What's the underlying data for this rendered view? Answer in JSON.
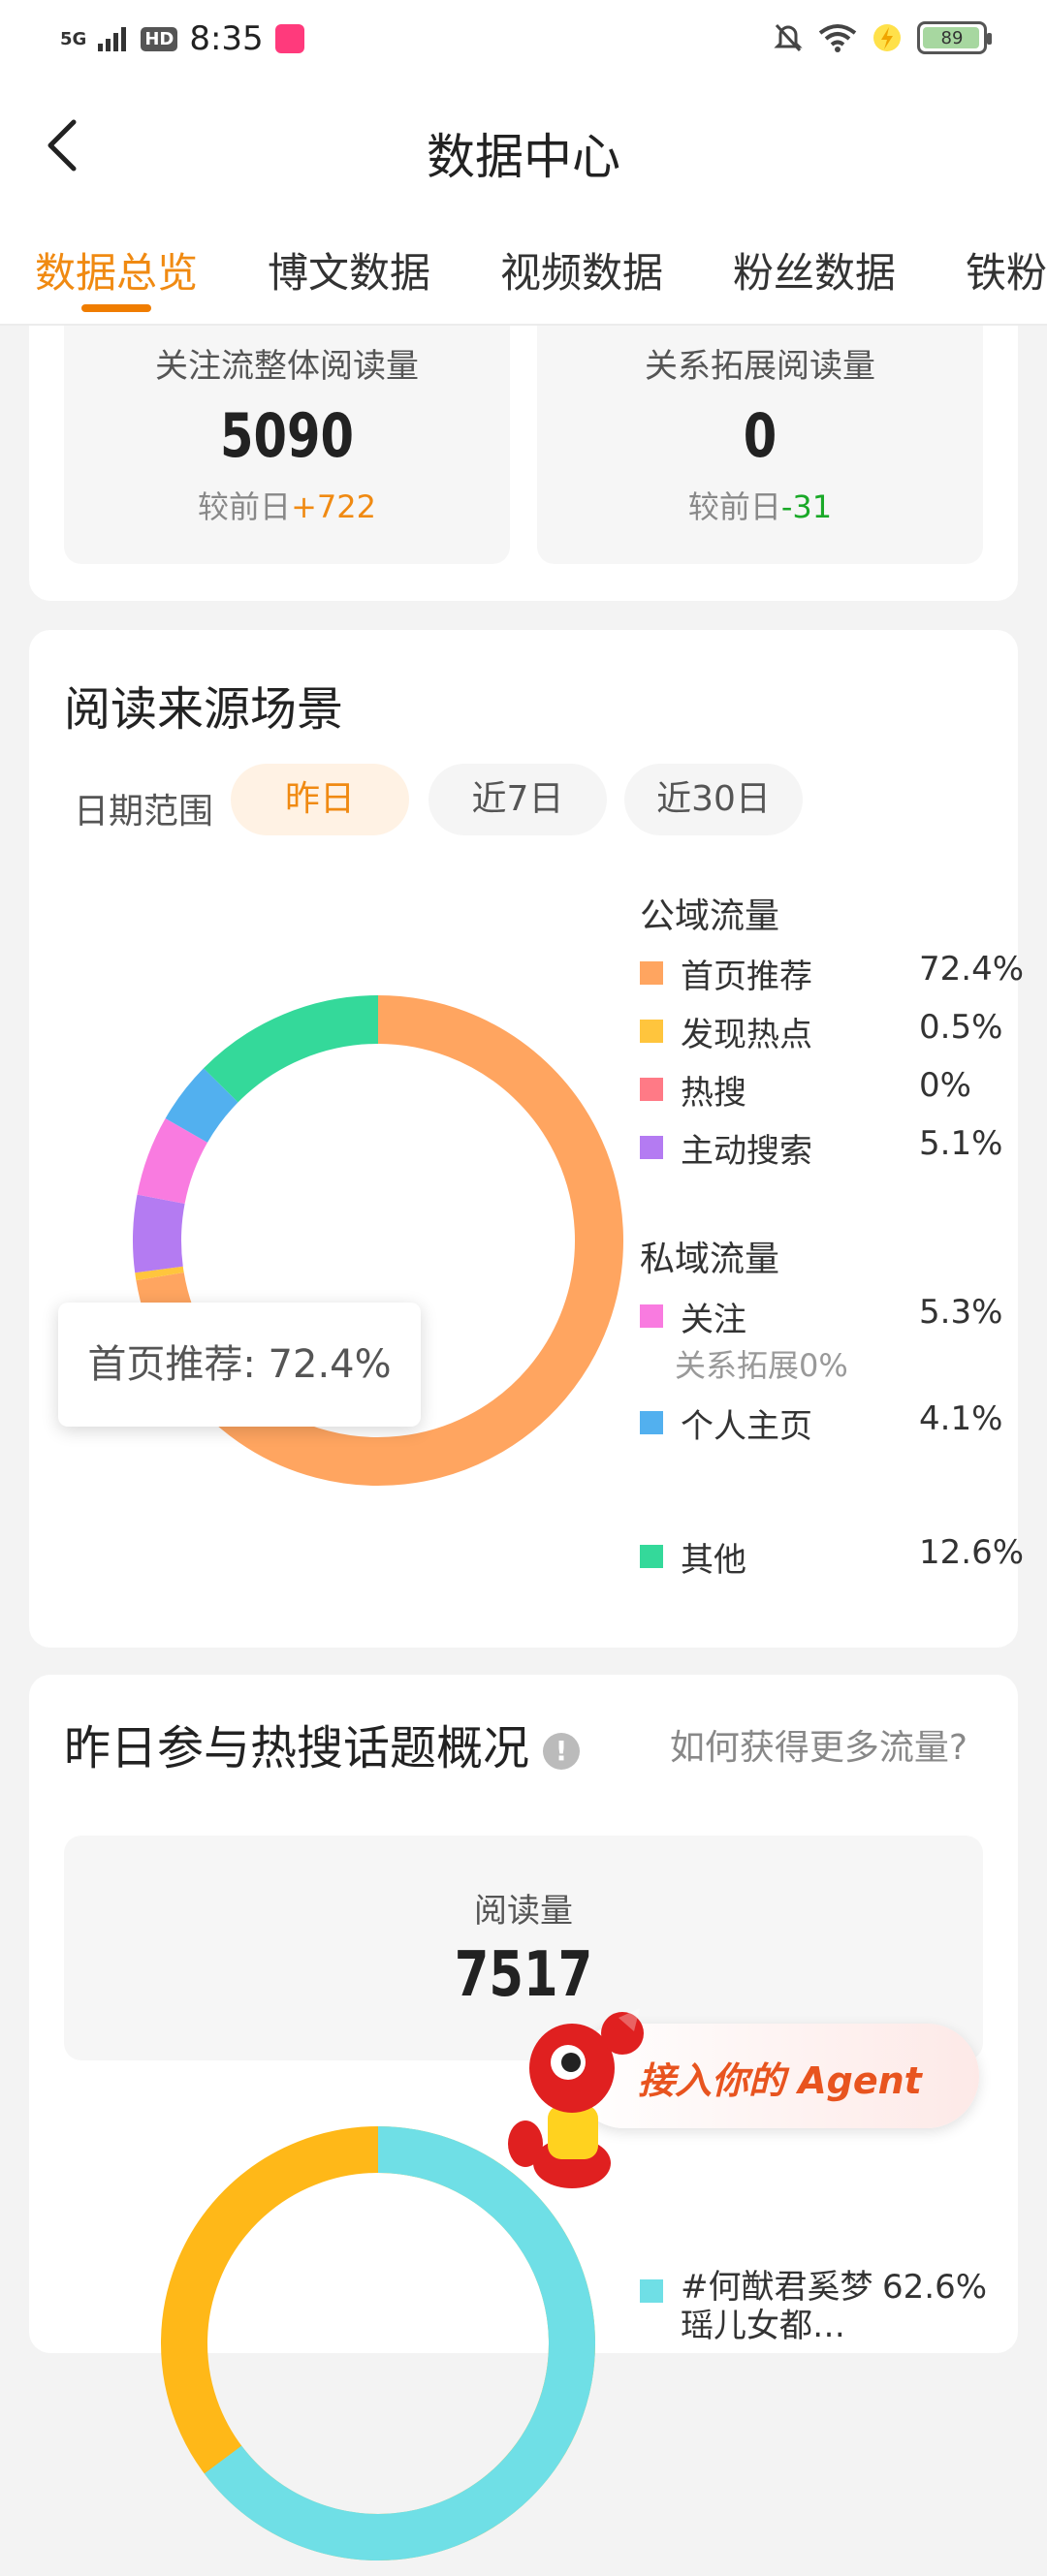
{
  "status": {
    "time": "8:35",
    "network": "5G",
    "hd": "HD",
    "battery": "89"
  },
  "nav": {
    "title": "数据中心"
  },
  "tabs": [
    "数据总览",
    "博文数据",
    "视频数据",
    "粉丝数据",
    "铁粉"
  ],
  "overview": {
    "left": {
      "label": "关注流整体阅读量",
      "value": "5090",
      "delta_prefix": "较前日",
      "delta": "+722"
    },
    "right": {
      "label": "关系拓展阅读量",
      "value": "0",
      "delta_prefix": "较前日",
      "delta": "-31"
    }
  },
  "source": {
    "title": "阅读来源场景",
    "range_label": "日期范围",
    "ranges": [
      "昨日",
      "近7日",
      "近30日"
    ],
    "tooltip": "首页推荐: 72.4%",
    "public_label": "公域流量",
    "private_label": "私域流量",
    "public_items": [
      {
        "name": "首页推荐",
        "pct": "72.4%",
        "color": "#ffa560"
      },
      {
        "name": "发现热点",
        "pct": "0.5%",
        "color": "#ffc53d"
      },
      {
        "name": "热搜",
        "pct": "0%",
        "color": "#ff7a86"
      },
      {
        "name": "主动搜索",
        "pct": "5.1%",
        "color": "#b47bf2"
      }
    ],
    "private_items": [
      {
        "name": "关注",
        "pct": "5.3%",
        "color": "#f97be0"
      },
      {
        "name": "个人主页",
        "pct": "4.1%",
        "color": "#52b0ef"
      }
    ],
    "sub_note": "关系拓展0%",
    "other": {
      "name": "其他",
      "pct": "12.6%",
      "color": "#34d99a"
    }
  },
  "chart_data": {
    "type": "pie",
    "categories": [
      "首页推荐",
      "发现热点",
      "热搜",
      "主动搜索",
      "关注",
      "个人主页",
      "其他"
    ],
    "values": [
      72.4,
      0.5,
      0,
      5.1,
      5.3,
      4.1,
      12.6
    ]
  },
  "hot": {
    "title": "昨日参与热搜话题概况",
    "help": "如何获得更多流量?",
    "read_label": "阅读量",
    "read_value": "7517",
    "legend_name": "#何猷君奚梦瑶儿女都…",
    "legend_pct": "62.6%"
  },
  "agent": {
    "label": "接入你的 Agent"
  }
}
